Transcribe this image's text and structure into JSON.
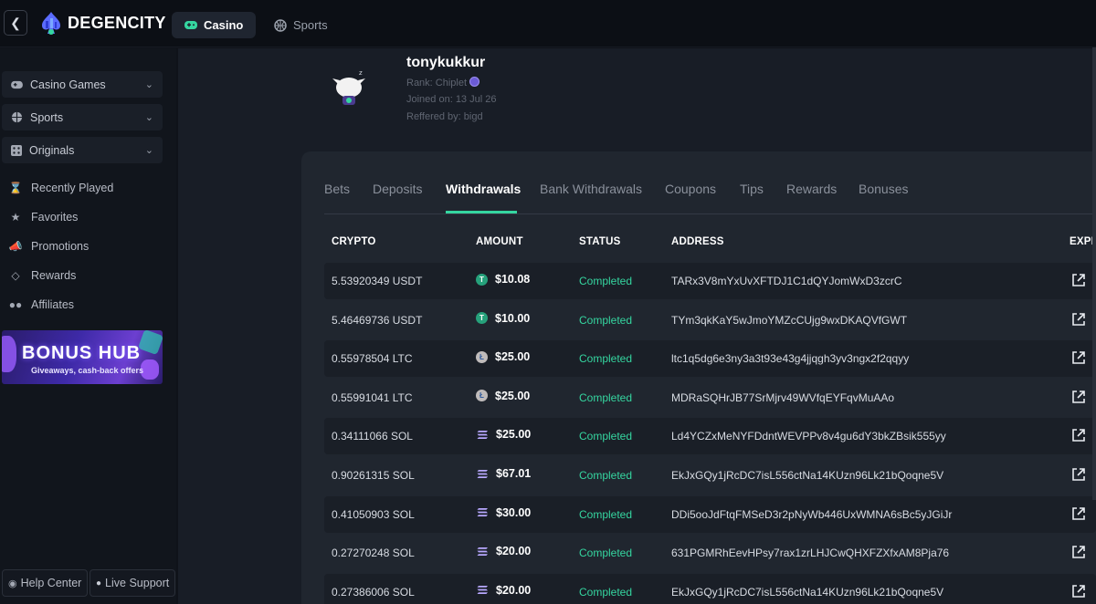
{
  "header": {
    "brand": "DEGENCITY",
    "nav": [
      {
        "label": "Casino",
        "icon": "gamepad-icon",
        "active": true
      },
      {
        "label": "Sports",
        "icon": "ball-icon",
        "active": false
      }
    ]
  },
  "sidebar": {
    "groups": [
      {
        "label": "Casino Games",
        "icon": "gamepad-icon"
      },
      {
        "label": "Sports",
        "icon": "ball-icon"
      },
      {
        "label": "Originals",
        "icon": "dice-icon"
      }
    ],
    "links": [
      {
        "label": "Recently Played",
        "icon": "hourglass-icon"
      },
      {
        "label": "Favorites",
        "icon": "star-icon"
      },
      {
        "label": "Promotions",
        "icon": "megaphone-icon"
      },
      {
        "label": "Rewards",
        "icon": "diamond-icon"
      },
      {
        "label": "Affiliates",
        "icon": "users-icon"
      }
    ],
    "banner": {
      "title": "BONUS HUB",
      "subtitle": "Giveaways, cash-back offers"
    },
    "footer": {
      "help": "Help Center",
      "support": "Live Support"
    }
  },
  "profile": {
    "username": "tonykukkur",
    "rank": "Rank: Chiplet",
    "joined": "Joined on: 13 Jul 26",
    "referred": "Reffered by: bigd"
  },
  "tabs": [
    "Bets",
    "Deposits",
    "Withdrawals",
    "Bank Withdrawals",
    "Coupons",
    "Tips",
    "Rewards",
    "Bonuses"
  ],
  "active_tab": "Withdrawals",
  "table": {
    "headers": {
      "crypto": "CRYPTO",
      "amount": "AMOUNT",
      "status": "STATUS",
      "address": "ADDRESS",
      "explorer": "EXPL"
    },
    "rows": [
      {
        "crypto": "5.53920349 USDT",
        "coin": "usdt",
        "amount": "$10.08",
        "status": "Completed",
        "address": "TARx3V8mYxUvXFTDJ1C1dQYJomWxD3zcrC"
      },
      {
        "crypto": "5.46469736 USDT",
        "coin": "usdt",
        "amount": "$10.00",
        "status": "Completed",
        "address": "TYm3qkKaY5wJmoYMZcCUjg9wxDKAQVfGWT"
      },
      {
        "crypto": "0.55978504 LTC",
        "coin": "ltc",
        "amount": "$25.00",
        "status": "Completed",
        "address": "ltc1q5dg6e3ny3a3t93e43g4jjqgh3yv3ngx2f2qqyy"
      },
      {
        "crypto": "0.55991041 LTC",
        "coin": "ltc",
        "amount": "$25.00",
        "status": "Completed",
        "address": "MDRaSQHrJB77SrMjrv49WVfqEYFqvMuAAo"
      },
      {
        "crypto": "0.34111066 SOL",
        "coin": "sol",
        "amount": "$25.00",
        "status": "Completed",
        "address": "Ld4YCZxMeNYFDdntWEVPPv8v4gu6dY3bkZBsik555yy"
      },
      {
        "crypto": "0.90261315 SOL",
        "coin": "sol",
        "amount": "$67.01",
        "status": "Completed",
        "address": "EkJxGQy1jRcDC7isL556ctNa14KUzn96Lk21bQoqne5V"
      },
      {
        "crypto": "0.41050903 SOL",
        "coin": "sol",
        "amount": "$30.00",
        "status": "Completed",
        "address": "DDi5ooJdFtqFMSeD3r2pNyWb446UxWMNA6sBc5yJGiJr"
      },
      {
        "crypto": "0.27270248 SOL",
        "coin": "sol",
        "amount": "$20.00",
        "status": "Completed",
        "address": "631PGMRhEevHPsy7rax1zrLHJCwQHXFZXfxAM8Pja76"
      },
      {
        "crypto": "0.27386006 SOL",
        "coin": "sol",
        "amount": "$20.00",
        "status": "Completed",
        "address": "EkJxGQy1jRcDC7isL556ctNa14KUzn96Lk21bQoqne5V"
      }
    ]
  },
  "colors": {
    "accent": "#35d6a0",
    "bg": "#181d26",
    "panel": "#20262f"
  }
}
